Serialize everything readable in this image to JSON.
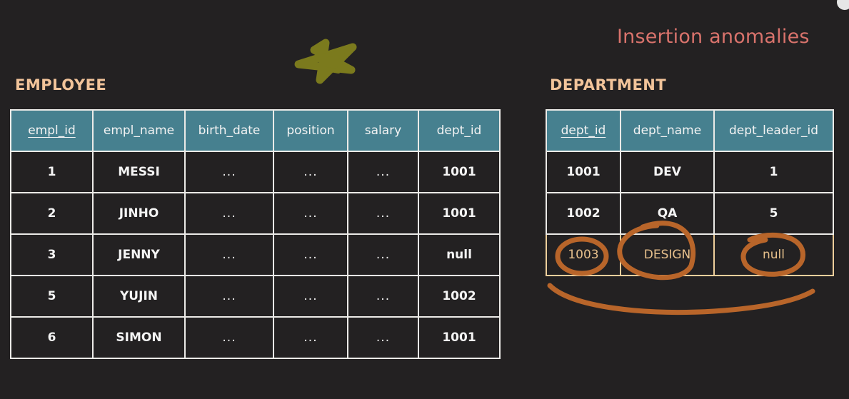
{
  "slide": {
    "title": "Insertion anomalies"
  },
  "employee": {
    "label": "EMPLOYEE",
    "columns": [
      "empl_id",
      "empl_name",
      "birth_date",
      "position",
      "salary",
      "dept_id"
    ],
    "rows": [
      [
        "1",
        "MESSI",
        "...",
        "...",
        "...",
        "1001"
      ],
      [
        "2",
        "JINHO",
        "...",
        "...",
        "...",
        "1001"
      ],
      [
        "3",
        "JENNY",
        "...",
        "...",
        "...",
        "null"
      ],
      [
        "5",
        "YUJIN",
        "...",
        "...",
        "...",
        "1002"
      ],
      [
        "6",
        "SIMON",
        "...",
        "...",
        "...",
        "1001"
      ]
    ]
  },
  "department": {
    "label": "DEPARTMENT",
    "columns": [
      "dept_id",
      "dept_name",
      "dept_leader_id"
    ],
    "rows": [
      [
        "1001",
        "DEV",
        "1"
      ],
      [
        "1002",
        "QA",
        "5"
      ],
      [
        "1003",
        "DESIGN",
        "null"
      ]
    ]
  },
  "colors": {
    "background": "#232122",
    "header_fill": "#46808f",
    "title": "#d9736c",
    "label": "#f2c49a",
    "annotation_orange": "#b8652a",
    "annotation_olive": "#7b7a1d"
  },
  "icons": {
    "star_scribble": "star-scribble-icon"
  }
}
